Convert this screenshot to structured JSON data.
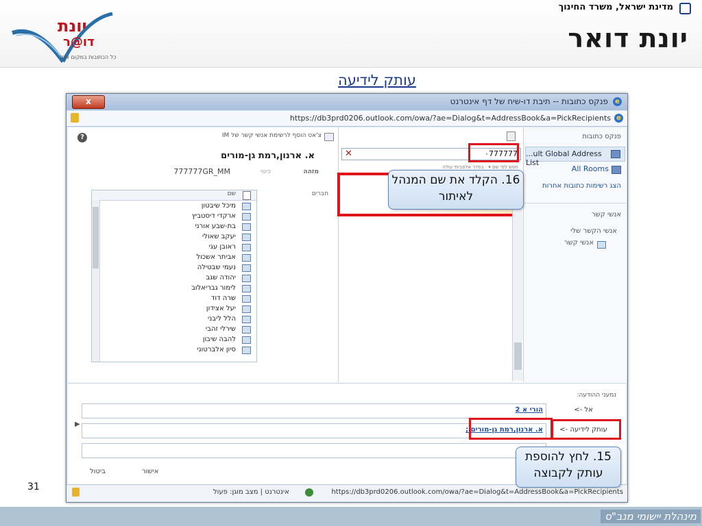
{
  "header": {
    "ministry": "מדינת ישראל, משרד החינוך",
    "brand_title": "יונת דואר",
    "logo_line1": "יונת",
    "logo_line2": "דו@ר",
    "logo_tagline": "כל הכתובות במקום אחד"
  },
  "slide": {
    "subtitle": "עותק לידיעה",
    "page_number": "31",
    "footer_text": "מינהלת יישומי מנב\"ס"
  },
  "window": {
    "title": "פנקס כתובות -- תיבת דו-שיח של דף אינטרנט",
    "close_label": "x",
    "url": "https://db3prd0206.outlook.com/owa/?ae=Dialog&t=AddressBook&a=PickRecipients",
    "status_url": "https://db3prd0206.outlook.com/owa/?ae=Dialog&t=AddressBook&a=PickRecipients",
    "status_zone": "אינטרנט | מצב מוגן: פעול"
  },
  "right_pane": {
    "title": "פנקס כתובות",
    "gal_label": "...ult Global Address List",
    "rooms_label": "All Rooms",
    "show_other": "הצג רשימות כתובות אחרות",
    "contacts_header": "אנשי קשר",
    "my_contacts": "אנשי הקשר שלי",
    "contacts_item": "אנשי קשר"
  },
  "middle_pane": {
    "search_value": "٠777777",
    "sort_text": "חפש לפי שם ▾ · בסדר אלפביתי עולה"
  },
  "left_pane": {
    "chat_link": "צ'אט   הוסף לרשימת אנשי קשר של IM",
    "contact_name": "א. ארנון,רמת גן-מורים",
    "email_label": "מזהה",
    "alias_label": "כינוי",
    "email_value": "777777GR_MM",
    "members_label": "חברים",
    "members_header": "שם",
    "members": [
      "מיכל שיבטון",
      "ארקדי דיסטביץ",
      "בת-שבע אורני",
      "יעקב שאולי",
      "ראובן עגי",
      "אביתר אשכול",
      "נעמי שבטילה",
      "יהודה שגב",
      "לימור גבריאלוב",
      "שרה דוד",
      "יעל אצידון",
      "הלל ליבני",
      "שירלי זהבי",
      "להבה שיבון",
      "סיון אלברטוני"
    ]
  },
  "bottom": {
    "recipients_label": "נמעני ההודעה:",
    "to_button": "אל ->",
    "cc_button": "עותק לידיעה ->",
    "to_value": "הורי א 2",
    "cc_value": "א. ארנון,רמת גן-מורים ;",
    "ok_label": "אישור",
    "cancel_label": "ביטול",
    "arrow": "▶"
  },
  "callouts": {
    "step16": "16. הקלד את שם המנהל לאיתור",
    "step15": "15. לחץ להוספת עותק לקבוצה"
  },
  "colors": {
    "highlight_red": "#e0131a",
    "callout_bg": "#cfe0f3",
    "link_blue": "#1d4fa6"
  }
}
